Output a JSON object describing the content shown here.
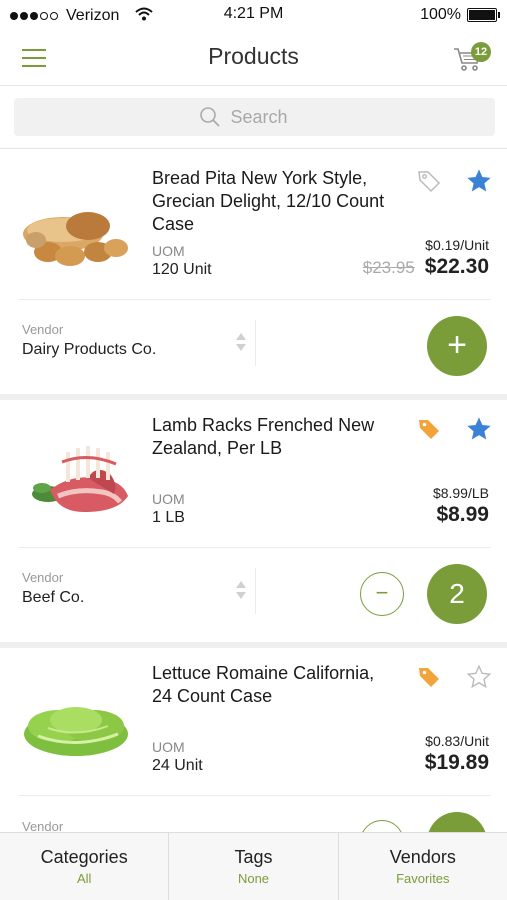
{
  "status_bar": {
    "carrier": "Verizon",
    "time": "4:21 PM",
    "battery": "100%"
  },
  "header": {
    "title": "Products",
    "cart_count": "12"
  },
  "search": {
    "placeholder": "Search"
  },
  "products": [
    {
      "name": "Bread Pita New York Style, Grecian Delight, 12/10 Count Case",
      "uom_label": "UOM",
      "uom": "120 Unit",
      "unit_price": "$0.19/Unit",
      "old_price": "$23.95",
      "price": "$22.30",
      "tag_state": "outline",
      "favorite": true,
      "vendor_label": "Vendor",
      "vendor": "Dairy Products Co.",
      "add_label": "+"
    },
    {
      "name": "Lamb Racks Frenched New Zealand, Per LB",
      "uom_label": "UOM",
      "uom": "1 LB",
      "unit_price": "$8.99/LB",
      "price": "$8.99",
      "tag_state": "filled",
      "favorite": true,
      "vendor_label": "Vendor",
      "vendor": "Beef Co.",
      "minus_label": "−",
      "quantity": "2"
    },
    {
      "name": "Lettuce Romaine California, 24 Count Case",
      "uom_label": "UOM",
      "uom": "24 Unit",
      "unit_price": "$0.83/Unit",
      "price": "$19.89",
      "tag_state": "filled",
      "favorite": false,
      "vendor_label": "Vendor"
    }
  ],
  "tabs": [
    {
      "title": "Categories",
      "subtitle": "All"
    },
    {
      "title": "Tags",
      "subtitle": "None"
    },
    {
      "title": "Vendors",
      "subtitle": "Favorites"
    }
  ],
  "colors": {
    "accent": "#7a9d3a",
    "tag": "#f2a33a",
    "star": "#3b82d6"
  }
}
